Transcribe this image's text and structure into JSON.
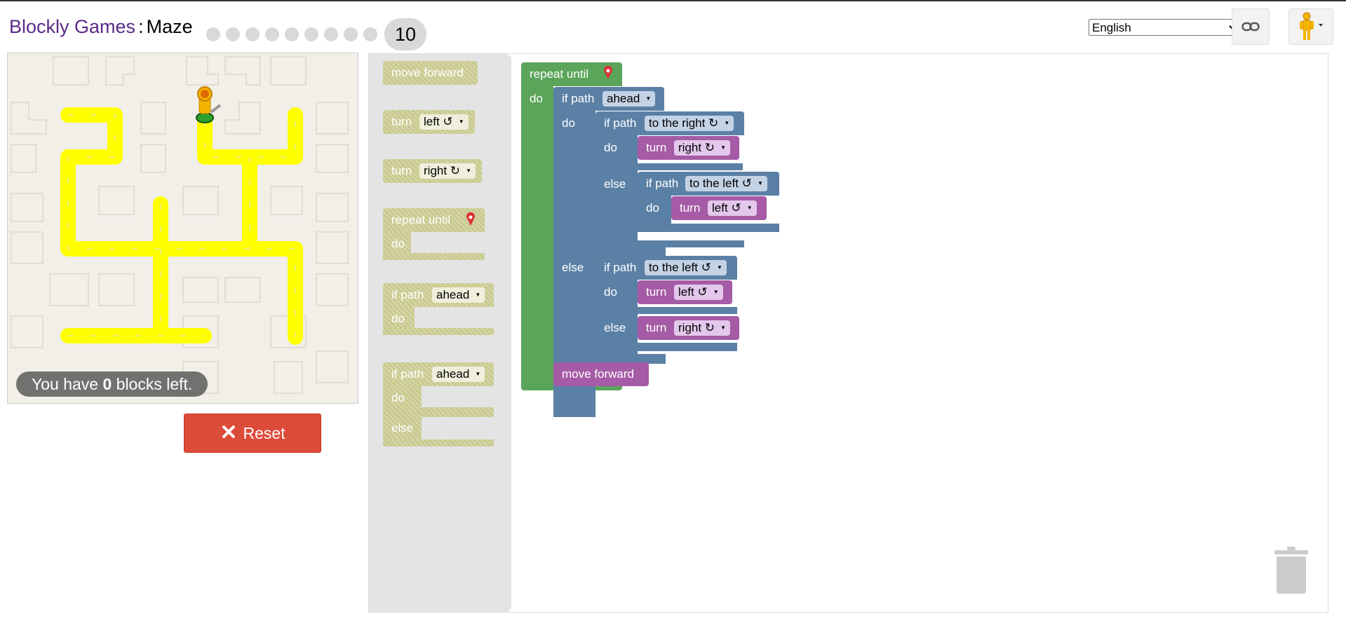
{
  "header": {
    "brand": "Blockly Games",
    "separator": ":",
    "title": "Maze",
    "current_level": "10",
    "total_levels": 10
  },
  "language": {
    "selected": "English"
  },
  "maze": {
    "blocks_left_prefix": "You have ",
    "blocks_left_count": "0",
    "blocks_left_suffix": " blocks left."
  },
  "controls": {
    "reset_label": "Reset",
    "reset_icon": "✕"
  },
  "toolbox": {
    "move_forward": "move forward",
    "turn": "turn",
    "left": "left ↺",
    "right": "right ↻",
    "repeat_until": "repeat until",
    "do": "do",
    "else": "else",
    "if_path": "if path",
    "ahead": "ahead"
  },
  "program": {
    "repeat_until": "repeat until",
    "do": "do",
    "else": "else",
    "if_path": "if path",
    "turn": "turn",
    "move_forward": "move forward",
    "ahead": "ahead",
    "to_the_right": "to the right ↻",
    "to_the_left": "to the left ↺",
    "right": "right ↻",
    "left": "left ↺"
  },
  "colors": {
    "loop": "#5ba55b",
    "logic": "#5b80a5",
    "movement": "#a55ba5",
    "path": "#ffff00",
    "reset": "#dd4b39",
    "brand": "#5b2a86"
  }
}
